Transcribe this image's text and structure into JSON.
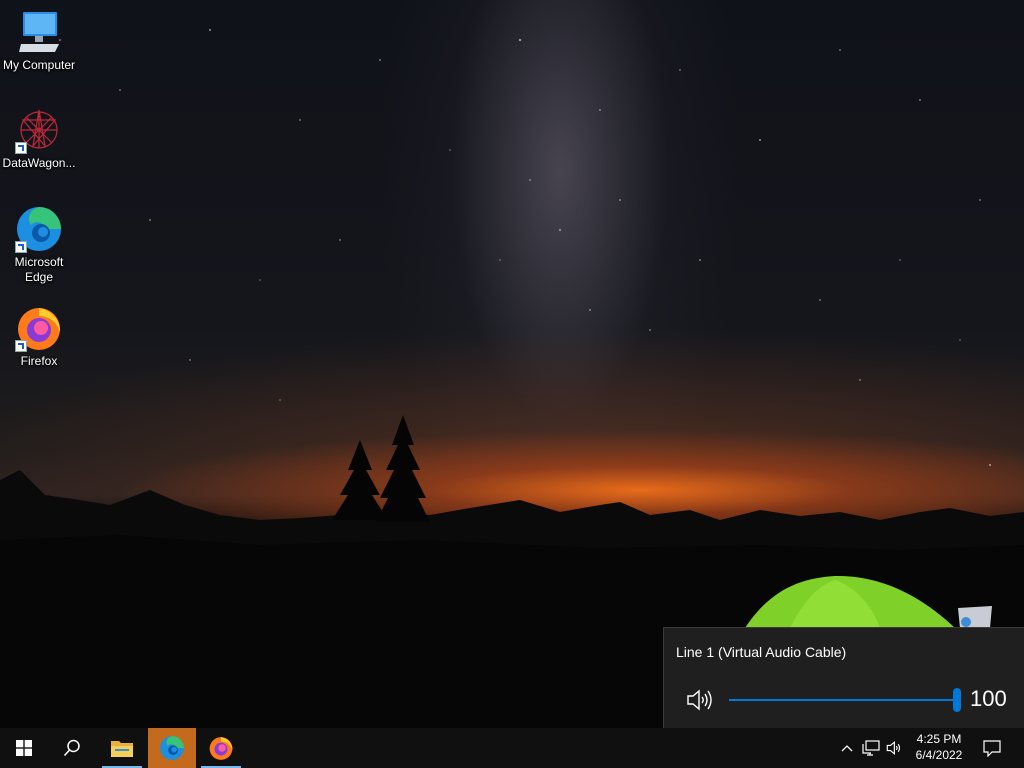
{
  "desktop": {
    "icons": [
      {
        "label": "My Computer",
        "icon": "computer-icon"
      },
      {
        "label": "DataWagon...",
        "icon": "datawagon-icon"
      },
      {
        "label": "Microsoft Edge",
        "icon": "edge-icon"
      },
      {
        "label": "Firefox",
        "icon": "firefox-icon"
      }
    ]
  },
  "volume_flyout": {
    "device_name": "Line 1 (Virtual Audio Cable)",
    "volume": "100",
    "volume_fraction": 1.0,
    "accent": "#0078d7"
  },
  "taskbar": {
    "items": [
      "start-icon",
      "search-icon",
      "file-explorer-icon",
      "edge-icon",
      "firefox-icon"
    ],
    "active_item": "edge-icon",
    "active_color": "#c36a1c"
  },
  "tray": {
    "time": "4:25 PM",
    "date": "6/4/2022",
    "icons": [
      "chevron-up-icon",
      "network-icon",
      "speaker-icon",
      "notification-icon"
    ]
  }
}
